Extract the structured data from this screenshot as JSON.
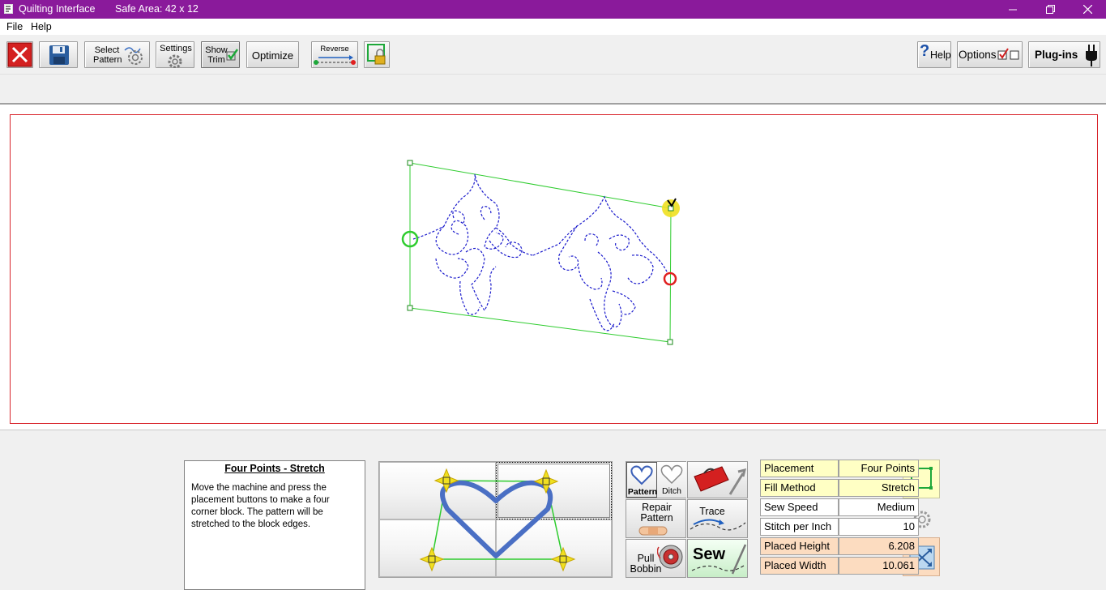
{
  "window": {
    "title": "Quilting Interface",
    "safe_area": "Safe Area:  42 x 12",
    "colors": {
      "titlebar": "#8a1a9b",
      "safe_area_border": "#d8232a",
      "pattern_outline": "#2ecc2e",
      "stitch": "#1a1acc"
    }
  },
  "menu": {
    "file": "File",
    "help": "Help"
  },
  "toolbar": {
    "close_icon": "red-x-icon",
    "save_icon": "floppy-disk-icon",
    "select_pattern": [
      "Select",
      "Pattern"
    ],
    "settings": "Settings",
    "show_trim": [
      "Show",
      "Trim"
    ],
    "optimize": "Optimize",
    "reverse": "Reverse",
    "lock_icon": "padlock-icon",
    "help": "Help",
    "options": "Options",
    "plugins": "Plug-ins"
  },
  "help_panel": {
    "title": "Four Points - Stretch",
    "text": "Move the machine and press the placement buttons to make a four corner block. The pattern will be stretched to the block edges."
  },
  "actions": {
    "pattern": "Pattern",
    "ditch": "Ditch",
    "repair_pattern": [
      "Repair",
      "Pattern"
    ],
    "trace": "Trace",
    "pull_bobbin": [
      "Pull",
      "Bobbin"
    ],
    "sew": "Sew"
  },
  "properties": [
    {
      "label": "Placement",
      "value": "Four Points",
      "style": "yellow"
    },
    {
      "label": "Fill Method",
      "value": "Stretch",
      "style": "yellow"
    },
    {
      "label": "Sew Speed",
      "value": "Medium",
      "style": "white"
    },
    {
      "label": "Stitch per Inch",
      "value": "10",
      "style": "white"
    },
    {
      "label": "Placed Height",
      "value": "6.208",
      "style": "peach"
    },
    {
      "label": "Placed Width",
      "value": "10.061",
      "style": "peach"
    }
  ]
}
